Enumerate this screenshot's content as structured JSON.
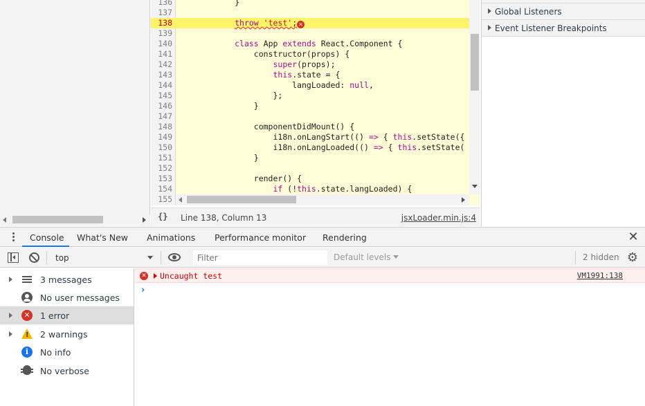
{
  "editor": {
    "lines": [
      {
        "num": "136",
        "html": "            }"
      },
      {
        "num": "137",
        "html": ""
      },
      {
        "num": "138",
        "html": "            <span class=\"squiggle\"><span class=\"kw\">throw</span> <span class=\"str\">'test'</span>;</span><span class=\"err-mark\">✕</span>",
        "error": true
      },
      {
        "num": "139",
        "html": ""
      },
      {
        "num": "140",
        "html": "            <span class=\"kw\">class</span> App <span class=\"kw\">extends</span> React.Component {"
      },
      {
        "num": "141",
        "html": "                constructor(props) {"
      },
      {
        "num": "142",
        "html": "                    <span class=\"kw\">super</span>(props);"
      },
      {
        "num": "143",
        "html": "                    <span class=\"kw\">this</span>.state = {"
      },
      {
        "num": "144",
        "html": "                        langLoaded: <span class=\"kw\">null</span>,"
      },
      {
        "num": "145",
        "html": "                    };"
      },
      {
        "num": "146",
        "html": "                }"
      },
      {
        "num": "147",
        "html": ""
      },
      {
        "num": "148",
        "html": "                componentDidMount() {"
      },
      {
        "num": "149",
        "html": "                    i18n.onLangStart(() <span class=\"kw\">=&gt;</span> { <span class=\"kw\">this</span>.setState({"
      },
      {
        "num": "150",
        "html": "                    i18n.onLangLoaded(() <span class=\"kw\">=&gt;</span> { <span class=\"kw\">this</span>.setState("
      },
      {
        "num": "151",
        "html": "                }"
      },
      {
        "num": "152",
        "html": ""
      },
      {
        "num": "153",
        "html": "                render() {"
      },
      {
        "num": "154",
        "html": "                    <span class=\"kw\">if</span> (!<span class=\"kw\">this</span>.state.langLoaded) {"
      },
      {
        "num": "155",
        "html": ""
      }
    ],
    "braces_label": "{}",
    "position": "Line 138, Column 13",
    "source_link": "jsxLoader.min.js:4"
  },
  "sidebar": {
    "panes": [
      "Global Listeners",
      "Event Listener Breakpoints"
    ]
  },
  "drawer": {
    "tabs": [
      "Console",
      "What's New",
      "Animations",
      "Performance monitor",
      "Rendering"
    ],
    "close_glyph": "✕"
  },
  "toolbar": {
    "context": "top",
    "filter_placeholder": "Filter",
    "levels": "Default levels",
    "hidden": "2 hidden",
    "settings_glyph": "⚙"
  },
  "console_sidebar": {
    "items": [
      {
        "label": "3 messages",
        "icon": "list-icon"
      },
      {
        "label": "No user messages",
        "icon": "user-icon"
      },
      {
        "label": "1 error",
        "icon": "error-icon"
      },
      {
        "label": "2 warnings",
        "icon": "warning-icon"
      },
      {
        "label": "No info",
        "icon": "info-icon"
      },
      {
        "label": "No verbose",
        "icon": "bug-icon"
      }
    ]
  },
  "console": {
    "error_message": "Uncaught test",
    "error_source": "VM1991:138",
    "prompt": "›"
  },
  "colors": {
    "editor_bg": "#fffdd7",
    "error_line": "#fef36a",
    "error_red": "#d93025",
    "accent": "#1a73e8"
  }
}
